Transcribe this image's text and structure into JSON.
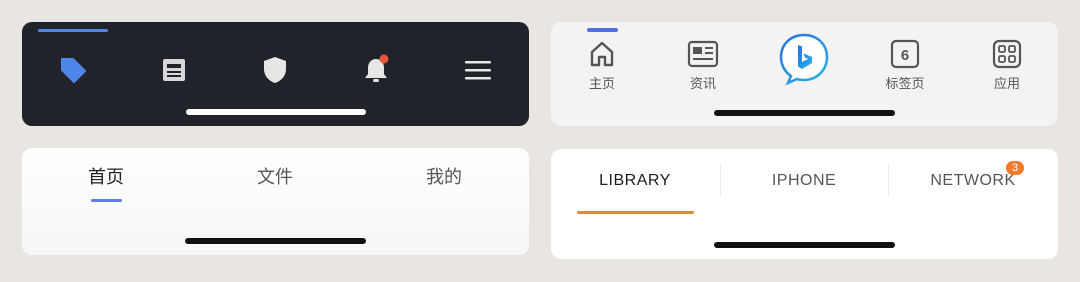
{
  "dark_tabbar": {
    "icons": [
      "tag-icon",
      "news-icon",
      "shield-icon",
      "bell-icon",
      "menu-icon"
    ],
    "colors": {
      "background": "#20232a",
      "accent": "#4f86e9",
      "badge": "#e8553d"
    }
  },
  "browser_tabbar": {
    "items": [
      {
        "label": "主页",
        "icon": "home-icon"
      },
      {
        "label": "资讯",
        "icon": "news-icon"
      },
      {
        "label": "",
        "icon": "bing-chat-icon"
      },
      {
        "label": "标签页",
        "icon": "tabs-icon",
        "count": "6"
      },
      {
        "label": "应用",
        "icon": "apps-icon"
      }
    ],
    "colors": {
      "background": "#f3f3f5",
      "accent": "#4f6fe0"
    }
  },
  "cn_tabs": {
    "tabs": [
      {
        "label": "首页",
        "active": true
      },
      {
        "label": "文件",
        "active": false
      },
      {
        "label": "我的",
        "active": false
      }
    ],
    "colors": {
      "indicator": "#5e7fe6"
    }
  },
  "library_tabs": {
    "tabs": [
      {
        "label": "LIBRARY",
        "active": true
      },
      {
        "label": "IPHONE",
        "active": false
      },
      {
        "label": "NETWORK",
        "active": false,
        "badge": "3"
      }
    ],
    "colors": {
      "indicator": "#e28a3b",
      "badge": "#ee7a2c"
    }
  }
}
